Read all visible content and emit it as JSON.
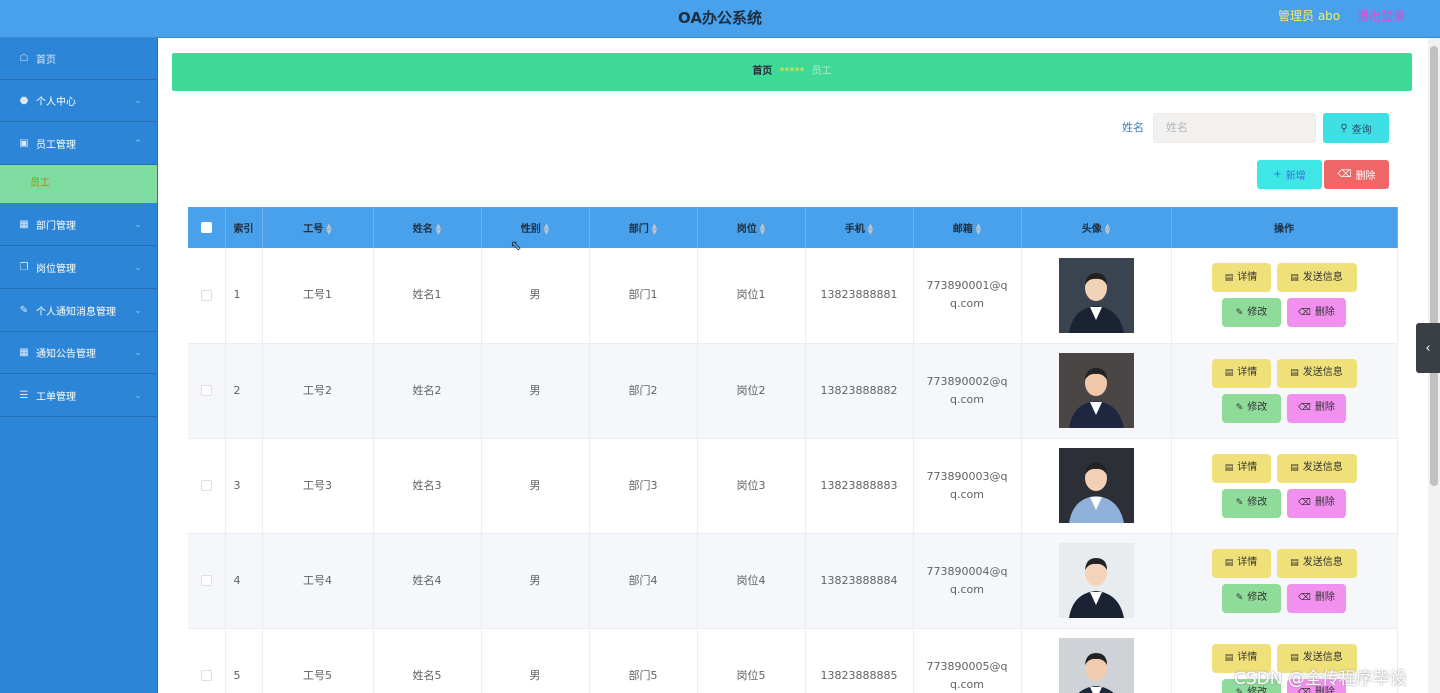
{
  "header": {
    "title": "OA办公系统",
    "admin_label": "管理员 abo",
    "logout_label": "退出登录"
  },
  "sidebar": {
    "items": [
      {
        "label": "首页",
        "icon": "home-icon"
      },
      {
        "label": "个人中心",
        "icon": "user-icon"
      },
      {
        "label": "员工管理",
        "icon": "expand-icon"
      },
      {
        "label": "部门管理",
        "icon": "briefcase-icon"
      },
      {
        "label": "岗位管理",
        "icon": "copy-icon"
      },
      {
        "label": "个人通知消息管理",
        "icon": "edit-icon"
      },
      {
        "label": "通知公告管理",
        "icon": "briefcase-icon"
      },
      {
        "label": "工单管理",
        "icon": "list-icon"
      }
    ],
    "active_submenu": "员工"
  },
  "breadcrumb": {
    "home": "首页",
    "separator": "*****",
    "current": "员工"
  },
  "search": {
    "label": "姓名",
    "placeholder": "姓名",
    "button": "查询"
  },
  "actions": {
    "add": "新增",
    "delete": "删除"
  },
  "table": {
    "columns": [
      "索引",
      "工号",
      "姓名",
      "性别",
      "部门",
      "岗位",
      "手机",
      "邮箱",
      "头像",
      "操作"
    ],
    "rows": [
      {
        "index": "1",
        "emp_no": "工号1",
        "name": "姓名1",
        "gender": "男",
        "dept": "部门1",
        "post": "岗位1",
        "phone": "13823888881",
        "email": "773890001@qq.com"
      },
      {
        "index": "2",
        "emp_no": "工号2",
        "name": "姓名2",
        "gender": "男",
        "dept": "部门2",
        "post": "岗位2",
        "phone": "13823888882",
        "email": "773890002@qq.com"
      },
      {
        "index": "3",
        "emp_no": "工号3",
        "name": "姓名3",
        "gender": "男",
        "dept": "部门3",
        "post": "岗位3",
        "phone": "13823888883",
        "email": "773890003@qq.com"
      },
      {
        "index": "4",
        "emp_no": "工号4",
        "name": "姓名4",
        "gender": "男",
        "dept": "部门4",
        "post": "岗位4",
        "phone": "13823888884",
        "email": "773890004@qq.com"
      },
      {
        "index": "5",
        "emp_no": "工号5",
        "name": "姓名5",
        "gender": "男",
        "dept": "部门5",
        "post": "岗位5",
        "phone": "13823888885",
        "email": "773890005@qq.com"
      }
    ],
    "row_actions": {
      "detail": "详情",
      "send": "发送信息",
      "edit": "修改",
      "delete": "删除"
    }
  },
  "watermark": "CSDN @全传程序毕设",
  "colors": {
    "header_bg": "#49a1eb",
    "sidebar_bg": "#2c85d6",
    "breadcrumb_bg": "#3dd995",
    "submenu_active_bg": "#7fdca0"
  }
}
